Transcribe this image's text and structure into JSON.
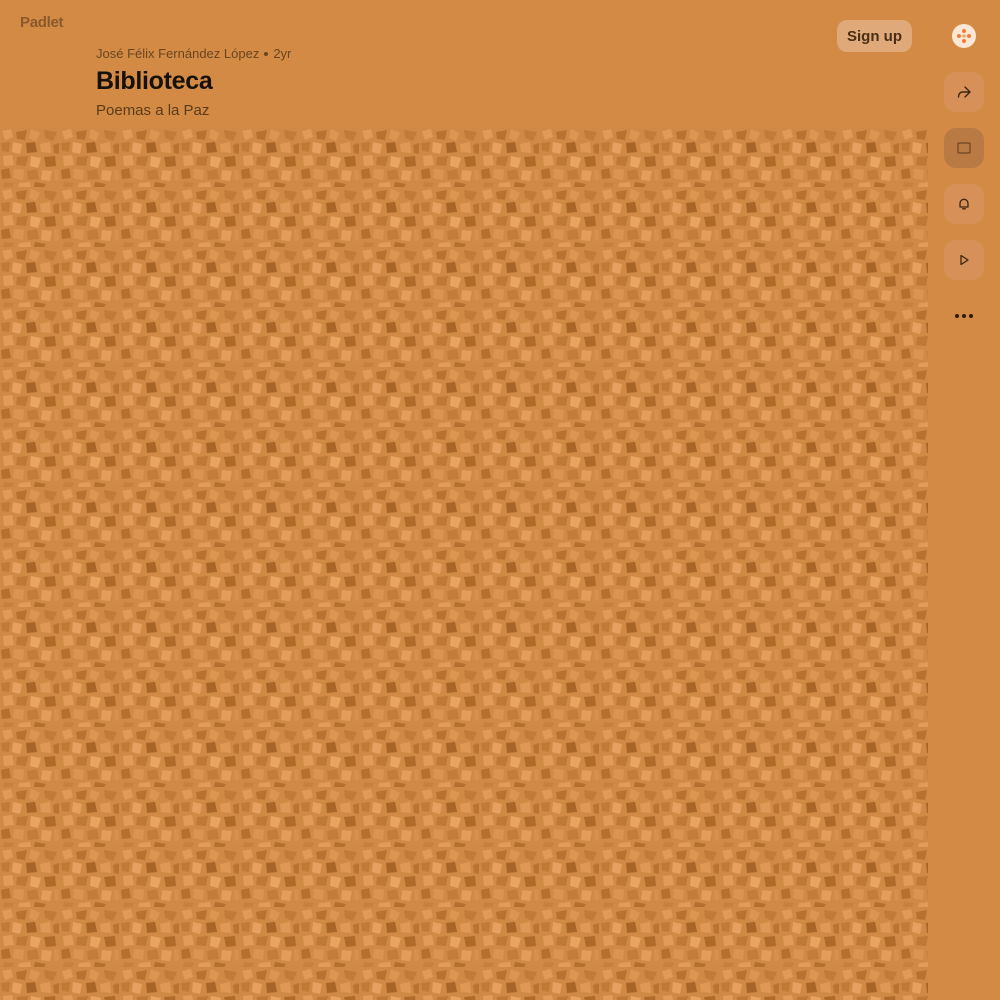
{
  "app": {
    "logo_text": "Padlet",
    "signup_label": "Sign up"
  },
  "board": {
    "author": "José Félix Fernández López",
    "age": "2yr",
    "title": "Biblioteca",
    "subtitle": "Poemas a la Paz"
  },
  "rail": {
    "items": [
      {
        "icon": "share-icon"
      },
      {
        "icon": "slideshow-icon"
      },
      {
        "icon": "bell-icon"
      },
      {
        "icon": "play-icon"
      },
      {
        "icon": "more-icon"
      }
    ]
  },
  "theme": {
    "background": "#d28a45",
    "cork": "#d08a46"
  }
}
